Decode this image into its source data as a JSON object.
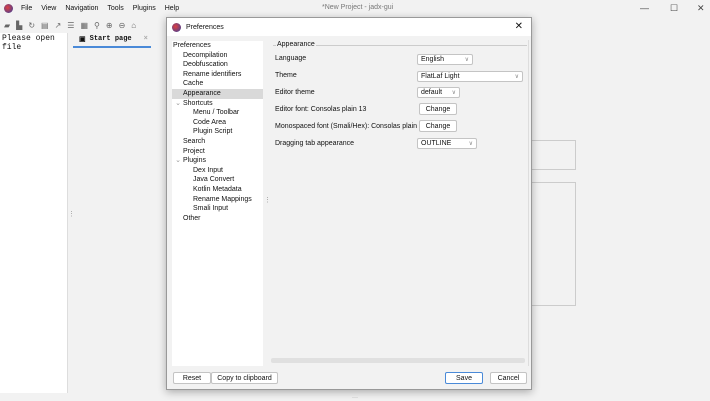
{
  "window": {
    "title": "*New Project - jadx-gui",
    "minimize": "—",
    "maximize": "☐",
    "close": "✕"
  },
  "menu": [
    "File",
    "View",
    "Navigation",
    "Tools",
    "Plugins",
    "Help"
  ],
  "toolbar_icons": [
    "open-icon",
    "add-files-icon",
    "sync-icon",
    "save-icon",
    "export-icon",
    "flatten-icon",
    "package-icon",
    "search-icon",
    "zoom-in-icon",
    "zoom-out-icon",
    "home-icon"
  ],
  "left_panel": {
    "text": "Please open file"
  },
  "tabs": [
    {
      "label": "Start page",
      "close": "×"
    }
  ],
  "dialog": {
    "title": "Preferences",
    "close": "✕",
    "tree": [
      {
        "label": "Preferences",
        "level": 0
      },
      {
        "label": "Decompilation",
        "level": 1
      },
      {
        "label": "Deobfuscation",
        "level": 1
      },
      {
        "label": "Rename identifiers",
        "level": 1
      },
      {
        "label": "Cache",
        "level": 1
      },
      {
        "label": "Appearance",
        "level": 1,
        "selected": true
      },
      {
        "label": "Shortcuts",
        "level": 1,
        "expanded": true
      },
      {
        "label": "Menu / Toolbar",
        "level": 2
      },
      {
        "label": "Code Area",
        "level": 2
      },
      {
        "label": "Plugin Script",
        "level": 2
      },
      {
        "label": "Search",
        "level": 1
      },
      {
        "label": "Project",
        "level": 1
      },
      {
        "label": "Plugins",
        "level": 1,
        "expanded": true
      },
      {
        "label": "Dex Input",
        "level": 2
      },
      {
        "label": "Java Convert",
        "level": 2
      },
      {
        "label": "Kotlin Metadata",
        "level": 2
      },
      {
        "label": "Rename Mappings",
        "level": 2
      },
      {
        "label": "Smali Input",
        "level": 2
      },
      {
        "label": "Other",
        "level": 1
      }
    ],
    "section": "Appearance",
    "settings": {
      "language": {
        "label": "Language",
        "value": "English"
      },
      "theme": {
        "label": "Theme",
        "value": "FlatLaf Light"
      },
      "editor_theme": {
        "label": "Editor theme",
        "value": "default"
      },
      "editor_font": {
        "label": "Editor font: Consolas plain 13",
        "button": "Change"
      },
      "mono_font": {
        "label": "Monospaced font (Smali/Hex): Consolas plain 13",
        "button": "Change"
      },
      "drag_tab": {
        "label": "Dragging tab appearance",
        "value": "OUTLINE"
      }
    },
    "buttons": {
      "reset": "Reset",
      "copy": "Copy to clipboard",
      "save": "Save",
      "cancel": "Cancel"
    }
  }
}
